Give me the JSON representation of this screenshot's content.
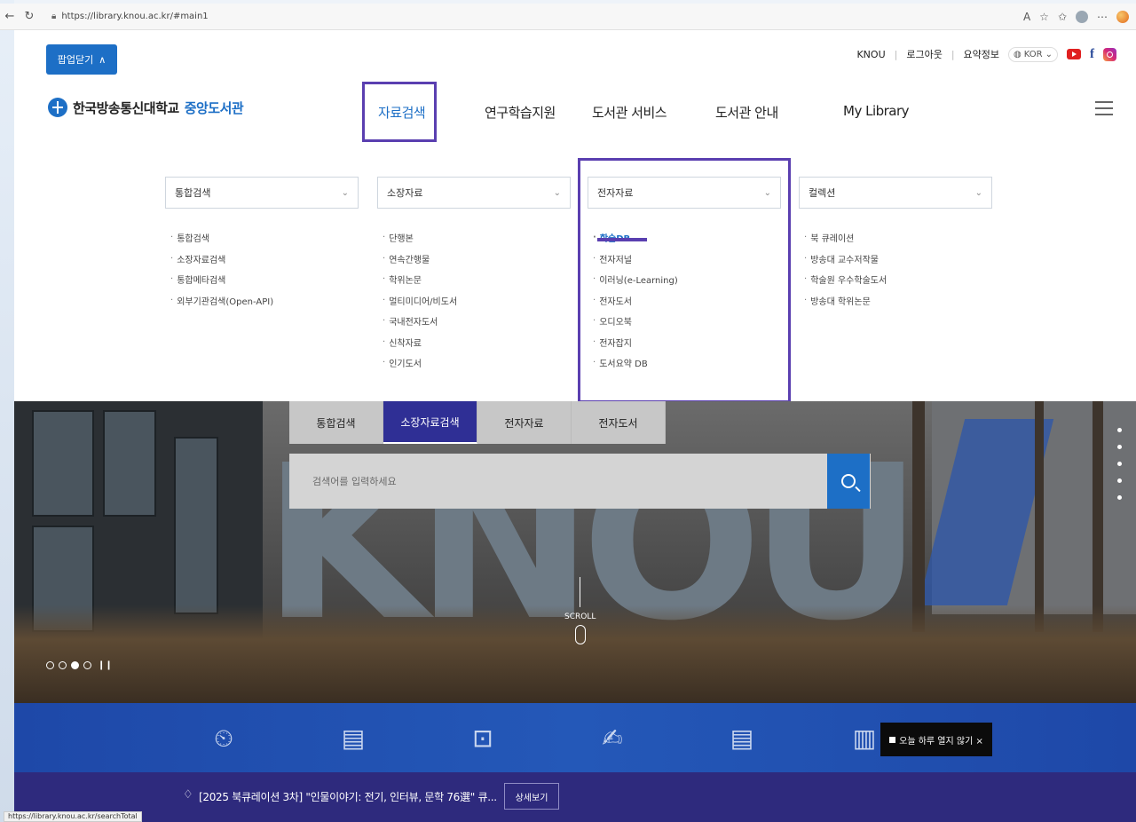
{
  "browser": {
    "url": "https://library.knou.ac.kr/#main1",
    "status_url": "https://library.knou.ac.kr/searchTotal"
  },
  "header": {
    "popup_toggle": "팝업닫기",
    "util_links": [
      "KNOU",
      "로그아웃",
      "요약정보"
    ],
    "language": "KOR",
    "logo_university": "한국방송통신대학교",
    "logo_library": "중앙도서관"
  },
  "gnb": [
    {
      "label": "자료검색"
    },
    {
      "label": "연구학습지원"
    },
    {
      "label": "도서관 서비스"
    },
    {
      "label": "도서관 안내"
    },
    {
      "label": "My Library"
    }
  ],
  "mega_menu": [
    {
      "title": "통합검색",
      "items": [
        "통합검색",
        "소장자료검색",
        "통합메타검색",
        "외부기관검색(Open-API)"
      ]
    },
    {
      "title": "소장자료",
      "items": [
        "단행본",
        "연속간행물",
        "학위논문",
        "멀티미디어/비도서",
        "국내전자도서",
        "신착자료",
        "인기도서"
      ]
    },
    {
      "title": "전자자료",
      "items": [
        "학술DB",
        "전자저널",
        "이러닝(e-Learning)",
        "전자도서",
        "오디오북",
        "전자잡지",
        "도서요약 DB"
      ]
    },
    {
      "title": "컬렉션",
      "items": [
        "북 큐레이션",
        "방송대 교수저작물",
        "학술원 우수학술도서",
        "방송대 학위논문"
      ]
    }
  ],
  "search": {
    "tabs": [
      "통합검색",
      "소장자료검색",
      "전자자료",
      "전자도서"
    ],
    "active_tab": "소장자료검색",
    "placeholder": "검색어를 입력하세요"
  },
  "hero": {
    "scroll_label": "SCROLL"
  },
  "toast": "오늘 하루 열지 않기 ×",
  "notice": {
    "text": "[2025 북큐레이션 3차] \"인물이야기: 전기, 인터뷰, 문학 76選\" 큐...",
    "more": "상세보기"
  },
  "colors": {
    "accent_blue": "#1d6fc6",
    "highlight_purple": "#5a3fb0",
    "notice_bg": "#2e2a7d",
    "quick_bg": "#2458b8"
  }
}
